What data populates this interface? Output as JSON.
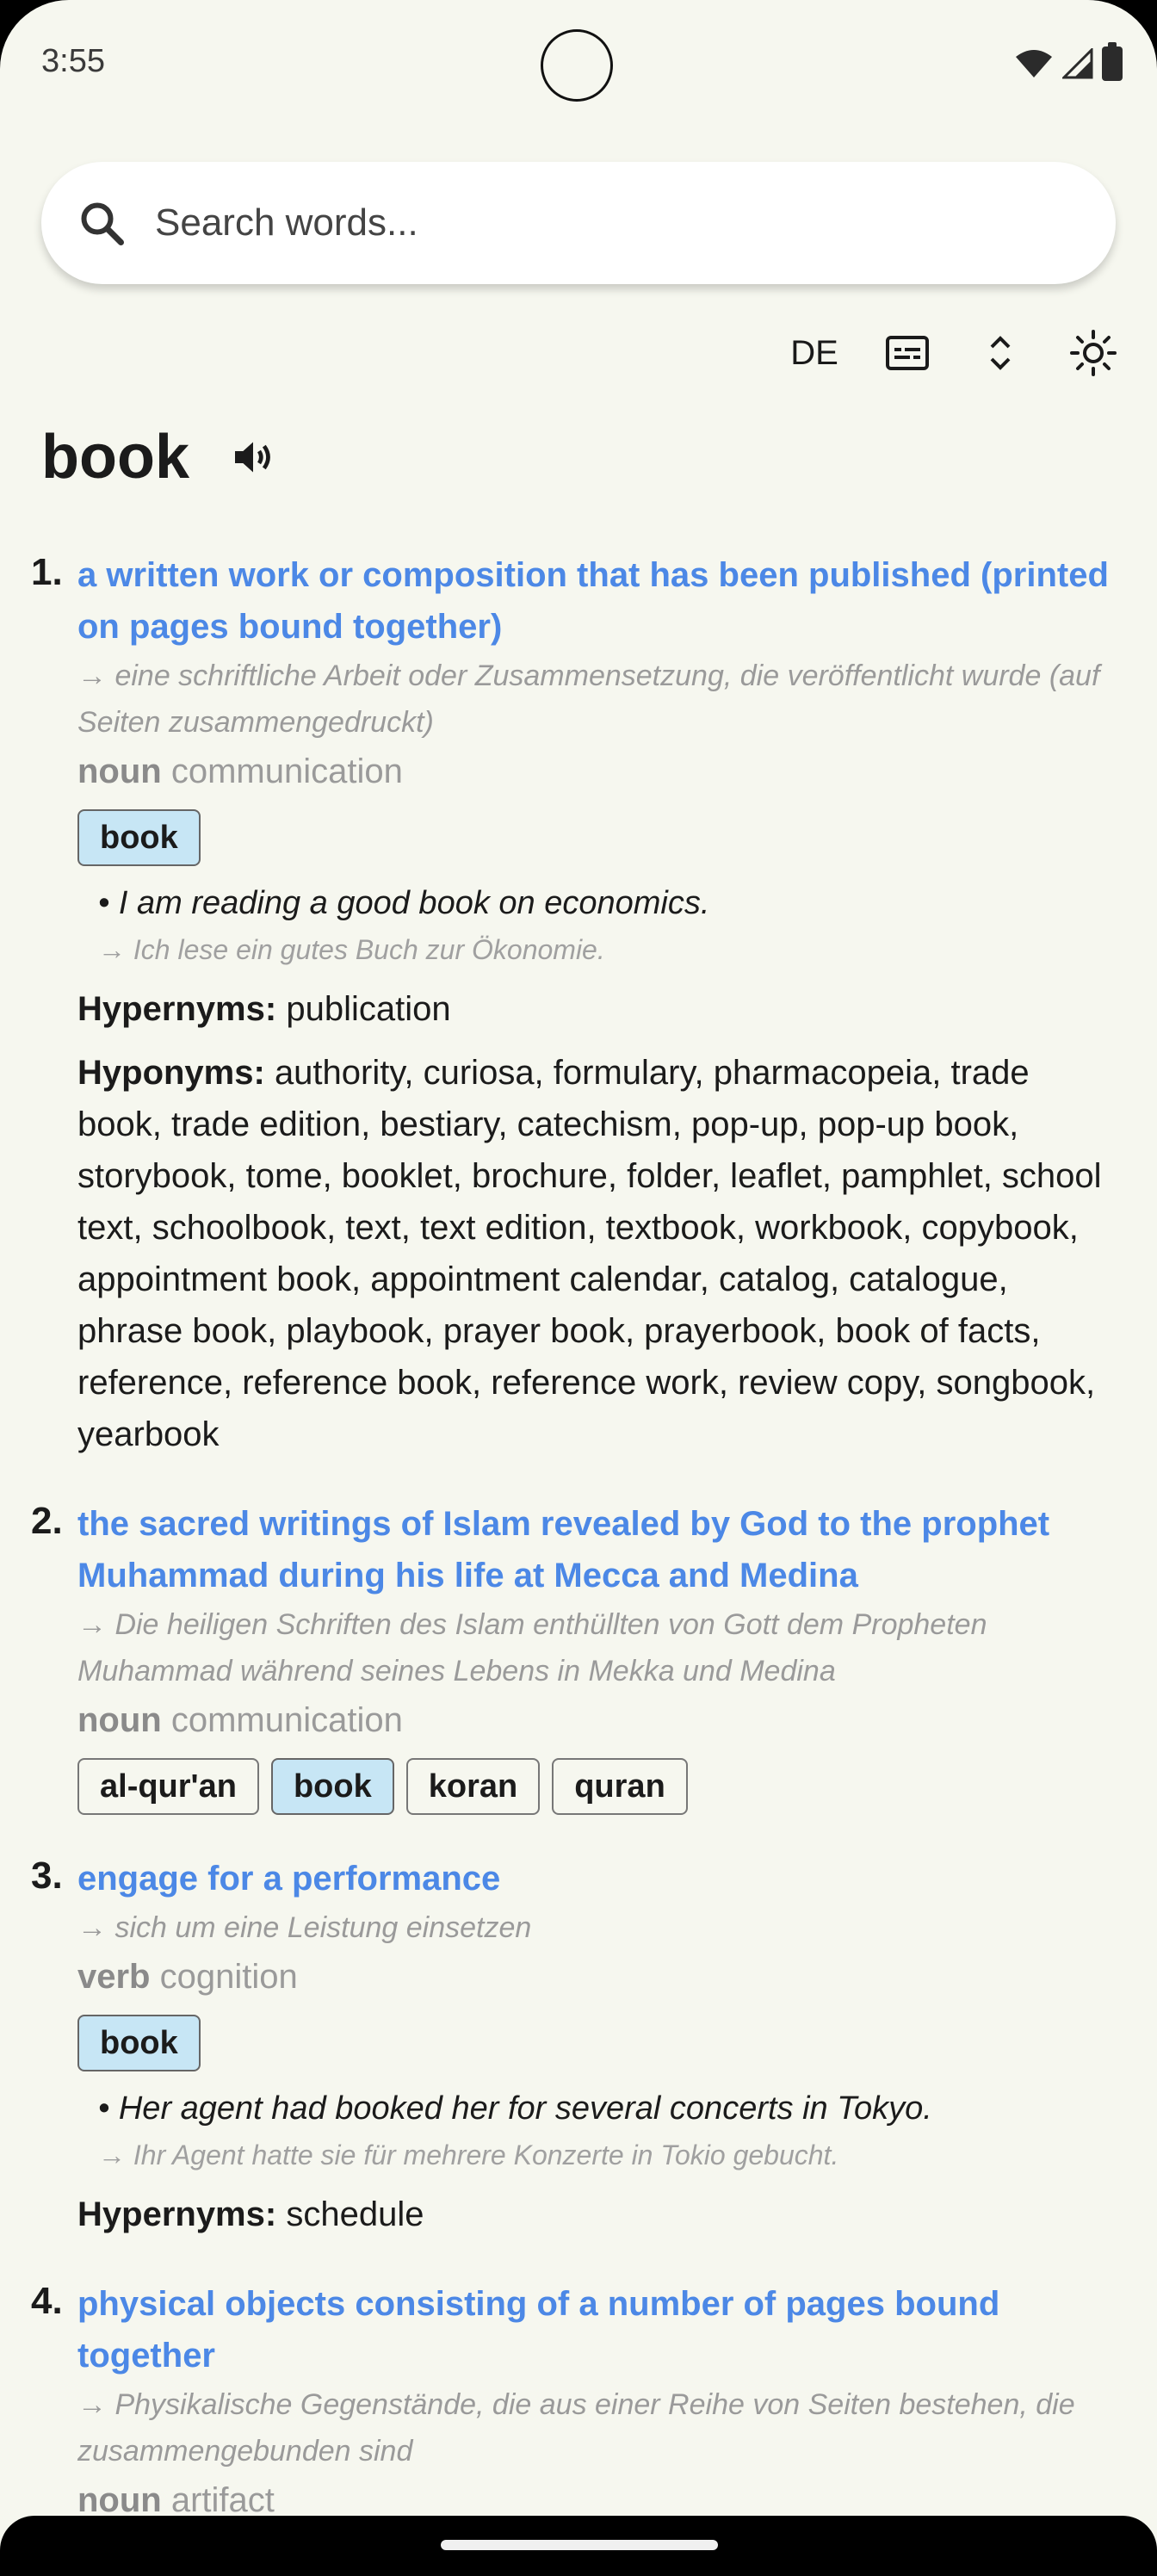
{
  "status": {
    "time": "3:55"
  },
  "search": {
    "placeholder": "Search words..."
  },
  "toolbar": {
    "lang": "DE"
  },
  "word": "book",
  "senses": [
    {
      "num": "1.",
      "gloss": "a written work or composition that has been published (printed on pages bound together)",
      "gloss_de": "→ eine schriftliche Arbeit oder Zusammensetzung, die veröffentlicht wurde (auf Seiten zusammengedruckt)",
      "pos": "noun",
      "category": "communication",
      "chips": [
        "book"
      ],
      "example": "• I am reading a good book on economics.",
      "example_de": "→ Ich lese ein gutes Buch zur Ökonomie.",
      "hypernyms_label": "Hypernyms:",
      "hypernyms": "publication",
      "hyponyms_label": "Hyponyms:",
      "hyponyms": "authority, curiosa, formulary, pharmacopeia, trade book, trade edition, bestiary, catechism, pop-up, pop-up book, storybook, tome, booklet, brochure, folder, leaflet, pamphlet, school text, schoolbook, text, text edition, textbook, workbook, copybook, appointment book, appointment calendar, catalog, catalogue, phrase book, playbook, prayer book, prayerbook, book of facts, reference, reference book, reference work, review copy, songbook, yearbook"
    },
    {
      "num": "2.",
      "gloss": "the sacred writings of Islam revealed by God to the prophet Muhammad during his life at Mecca and Medina",
      "gloss_de": "→ Die heiligen Schriften des Islam enthüllten von Gott dem Propheten Muhammad während seines Lebens in Mekka und Medina",
      "pos": "noun",
      "category": "communication",
      "chips": [
        "al-qur'an",
        "book",
        "koran",
        "quran"
      ]
    },
    {
      "num": "3.",
      "gloss": "engage for a performance",
      "gloss_de": "→ sich um eine Leistung einsetzen",
      "pos": "verb",
      "category": "cognition",
      "chips": [
        "book"
      ],
      "example": "• Her agent had booked her for several concerts in Tokyo.",
      "example_de": "→ Ihr Agent hatte sie für mehrere Konzerte in Tokio gebucht.",
      "hypernyms_label": "Hypernyms:",
      "hypernyms": "schedule"
    },
    {
      "num": "4.",
      "gloss": "physical objects consisting of a number of pages bound together",
      "gloss_de": "→ Physikalische Gegenstände, die aus einer Reihe von Seiten bestehen, die zusammengebunden sind",
      "pos": "noun",
      "category": "artifact"
    }
  ]
}
